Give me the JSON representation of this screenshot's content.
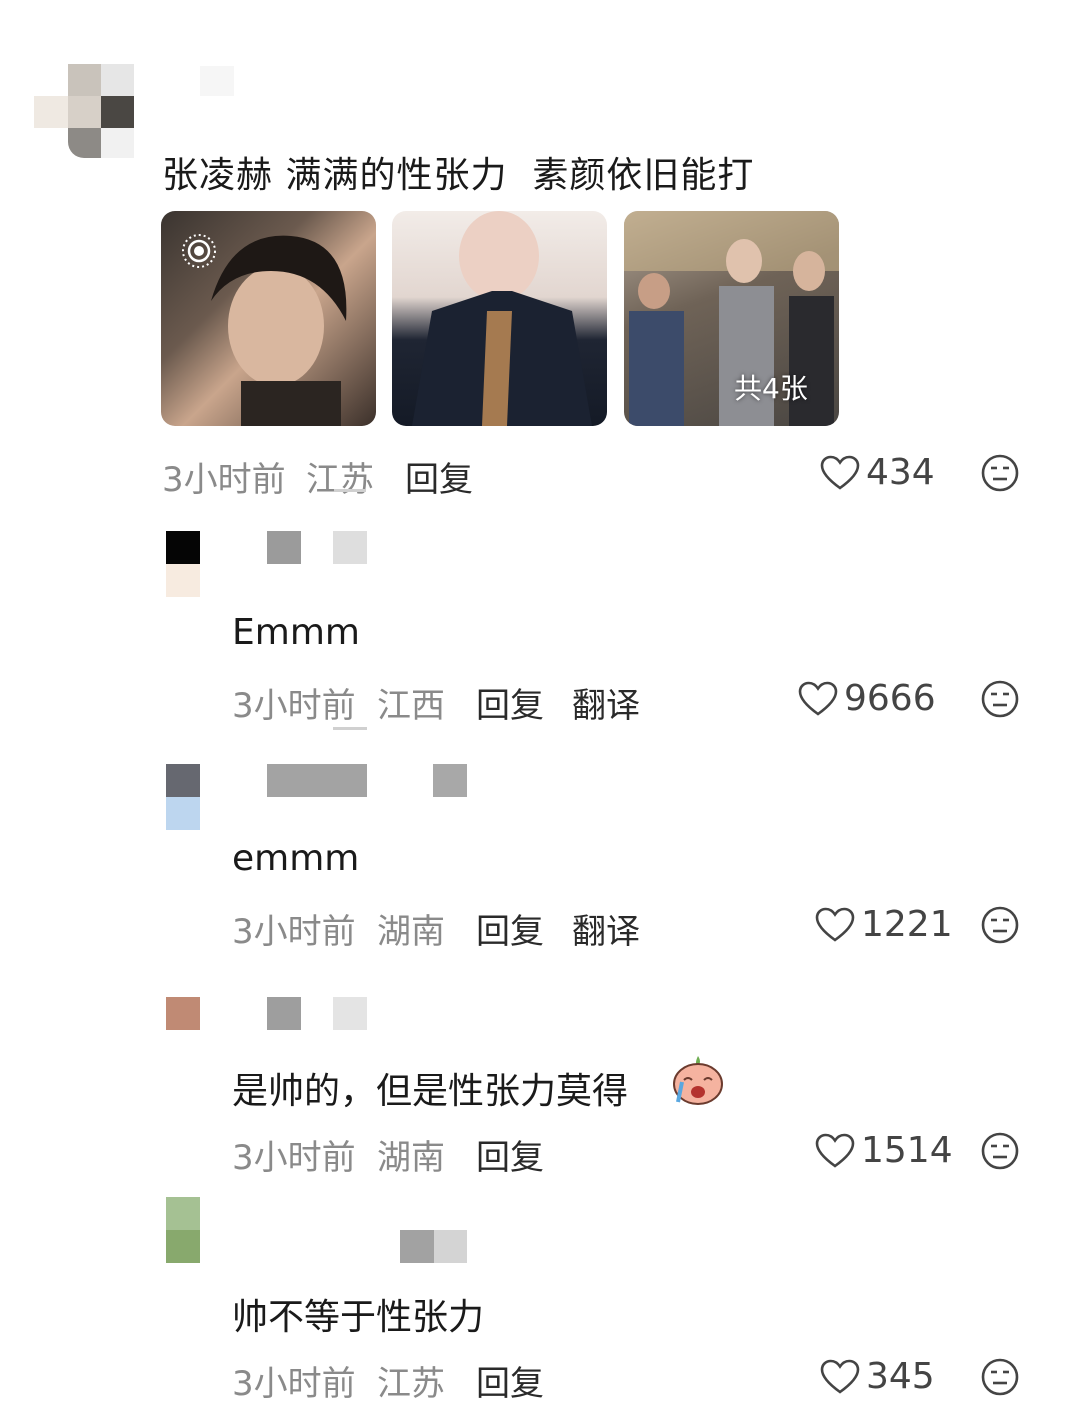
{
  "main_comment": {
    "text": "张凌赫 满满的性张力  素颜依旧能打",
    "images_count_label": "共4张",
    "time": "3小时前",
    "location": "江苏",
    "reply_label": "回复",
    "likes": "434"
  },
  "replies": [
    {
      "text": "Emmm",
      "time": "3小时前",
      "location": "江西",
      "reply_label": "回复",
      "translate_label": "翻译",
      "likes": "9666"
    },
    {
      "text": "emmm",
      "time": "3小时前",
      "location": "湖南",
      "reply_label": "回复",
      "translate_label": "翻译",
      "likes": "1221"
    },
    {
      "text": "是帅的，但是性张力莫得",
      "time": "3小时前",
      "location": "湖南",
      "reply_label": "回复",
      "likes": "1514"
    },
    {
      "text": "帅不等于性张力",
      "time": "3小时前",
      "location": "江苏",
      "reply_label": "回复",
      "likes": "345"
    }
  ],
  "icons": [
    "heart-icon",
    "neutral-face-icon",
    "live-photo-icon",
    "crying-peach-emoji"
  ],
  "colors": {
    "meta_text": "#8a8a8a",
    "body_text": "#1a1a1a"
  }
}
